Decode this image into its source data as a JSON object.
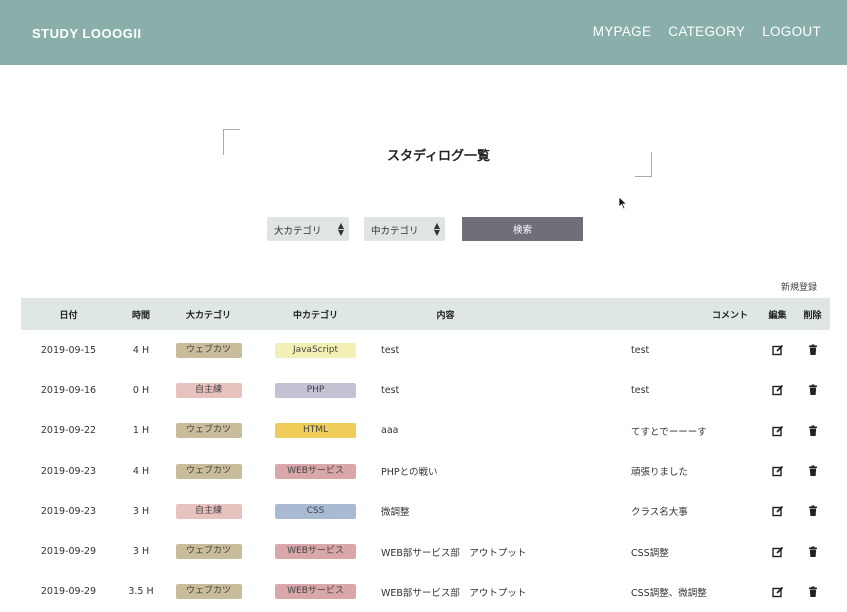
{
  "header": {
    "brand": "STUDY LOOOGII",
    "nav": [
      "MYPAGE",
      "CATEGORY",
      "LOGOUT"
    ],
    "bg_color": "#8aafab"
  },
  "page": {
    "title": "スタディログ一覧"
  },
  "filters": {
    "large_category": "大カテゴリ",
    "mid_category": "中カテゴリ",
    "search_label": "検索"
  },
  "new_link": "新規登録",
  "table": {
    "headers": {
      "date": "日付",
      "time": "時間",
      "large": "大カテゴリ",
      "mid": "中カテゴリ",
      "content": "内容",
      "comment": "コメント",
      "edit": "編集",
      "delete": "削除"
    },
    "rows": [
      {
        "date": "2019-09-15",
        "time": "4 H",
        "large": "ウェブカツ",
        "large_color": "#c8bc9a",
        "mid": "JavaScript",
        "mid_color": "#f2f0b4",
        "content": "test",
        "comment": "test"
      },
      {
        "date": "2019-09-16",
        "time": "0 H",
        "large": "自主練",
        "large_color": "#e8c2bf",
        "mid": "PHP",
        "mid_color": "#c3c2d4",
        "content": "test",
        "comment": "test"
      },
      {
        "date": "2019-09-22",
        "time": "1 H",
        "large": "ウェブカツ",
        "large_color": "#c8bc9a",
        "mid": "HTML",
        "mid_color": "#efcd58",
        "content": "aaa",
        "comment": "てすとでーーーす"
      },
      {
        "date": "2019-09-23",
        "time": "4 H",
        "large": "ウェブカツ",
        "large_color": "#c8bc9a",
        "mid": "WEBサービス",
        "mid_color": "#d9a7a9",
        "content": "PHPとの戦い",
        "comment": "頑張りました"
      },
      {
        "date": "2019-09-23",
        "time": "3 H",
        "large": "自主練",
        "large_color": "#e8c2bf",
        "mid": "CSS",
        "mid_color": "#a9bad3",
        "content": "微調整",
        "comment": "クラス名大事"
      },
      {
        "date": "2019-09-29",
        "time": "3 H",
        "large": "ウェブカツ",
        "large_color": "#c8bc9a",
        "mid": "WEBサービス",
        "mid_color": "#d9a7a9",
        "content": "WEB部サービス部　アウトプット",
        "comment": "CSS調整"
      },
      {
        "date": "2019-09-29",
        "time": "3.5 H",
        "large": "ウェブカツ",
        "large_color": "#c8bc9a",
        "mid": "WEBサービス",
        "mid_color": "#d9a7a9",
        "content": "WEB部サービス部　アウトプット",
        "comment": "CSS調整、微調整"
      }
    ]
  },
  "icons": {
    "edit": "edit-icon",
    "delete": "trash-icon",
    "cursor": "mouse-cursor-icon"
  }
}
